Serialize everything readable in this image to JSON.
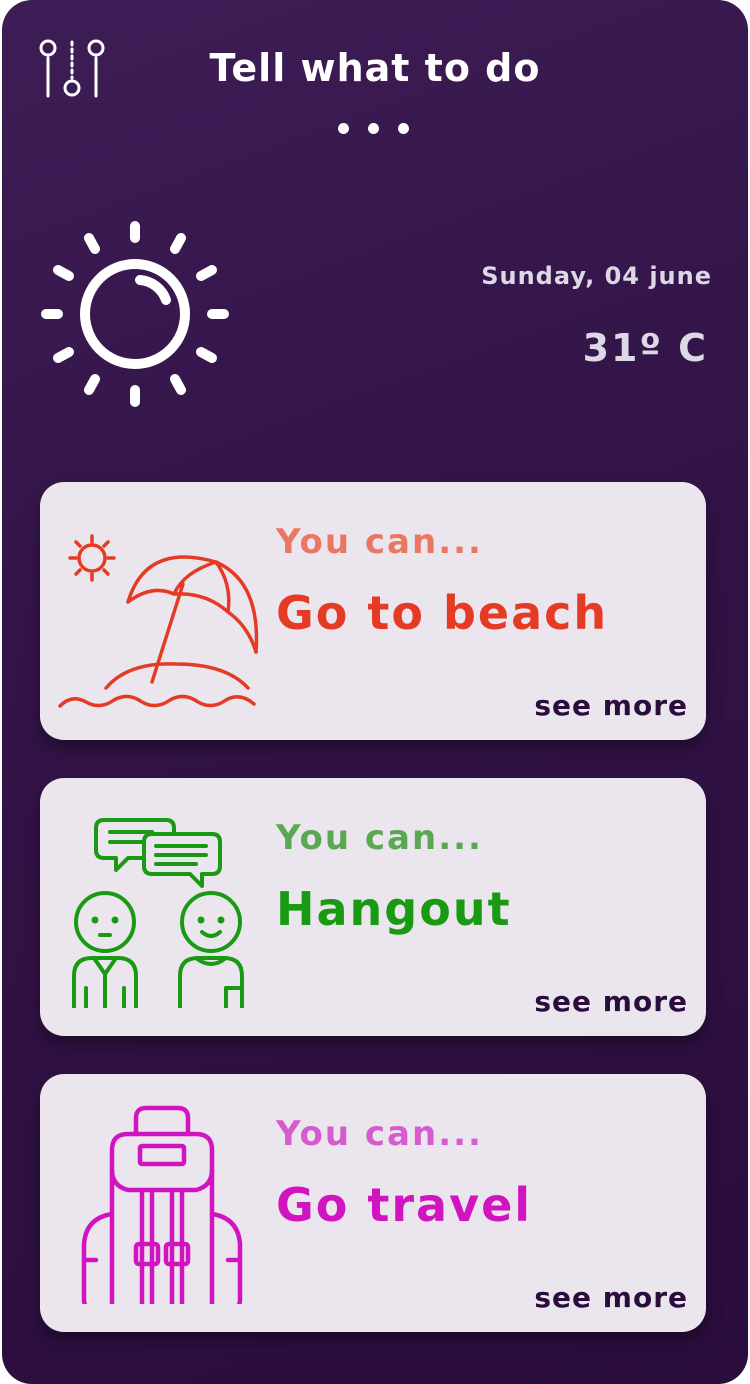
{
  "header": {
    "title": "Tell what to do",
    "filter_icon": "filter-sliders-icon",
    "menu_icon": "more-dots-icon"
  },
  "weather": {
    "icon": "sun-icon",
    "date": "Sunday, 04 june",
    "temperature": "31º C"
  },
  "suggestions": [
    {
      "icon": "beach-umbrella-icon",
      "lead": "You can...",
      "activity": "Go to beach",
      "action": "see more",
      "color": "#e53a24",
      "lead_color": "#e87864"
    },
    {
      "icon": "people-chatting-icon",
      "lead": "You can...",
      "activity": "Hangout",
      "action": "see more",
      "color": "#1a9a12",
      "lead_color": "#5aa852"
    },
    {
      "icon": "backpack-icon",
      "lead": "You can...",
      "activity": "Go travel",
      "action": "see more",
      "color": "#d015c0",
      "lead_color": "#d65ccd"
    }
  ],
  "colors": {
    "background": "#331349",
    "card": "#ebe6ee",
    "text_light": "#ffffff",
    "text_dark": "#2a0d3c"
  }
}
